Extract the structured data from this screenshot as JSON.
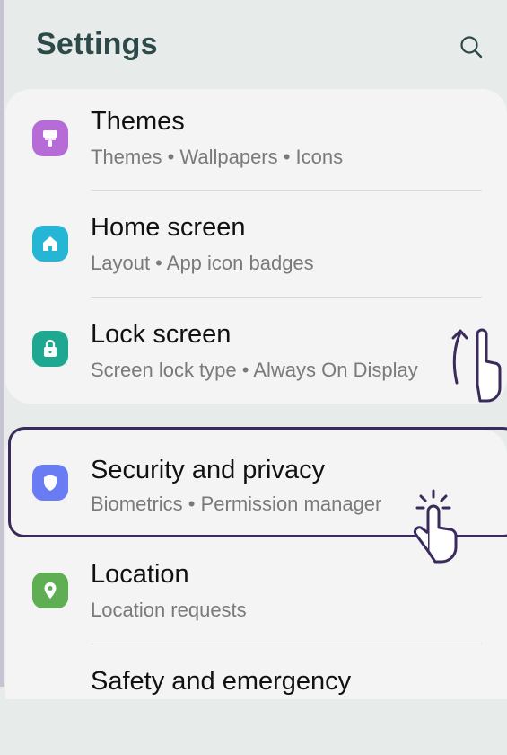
{
  "header": {
    "title": "Settings",
    "search_icon": "search-icon"
  },
  "items": [
    {
      "title": "Themes",
      "subtitle": "Themes  •  Wallpapers  •  Icons",
      "icon": "themes-icon",
      "color": "#b66bd6"
    },
    {
      "title": "Home screen",
      "subtitle": "Layout  •  App icon badges",
      "icon": "home-icon",
      "color": "#25b6d6"
    },
    {
      "title": "Lock screen",
      "subtitle": "Screen lock type  •  Always On Display",
      "icon": "lock-icon",
      "color": "#1fa891"
    },
    {
      "title": "Security and privacy",
      "subtitle": "Biometrics  •  Permission manager",
      "icon": "shield-icon",
      "color": "#6a7cf4"
    },
    {
      "title": "Location",
      "subtitle": "Location requests",
      "icon": "location-icon",
      "color": "#5fae54"
    },
    {
      "title": "Safety and emergency",
      "subtitle": "",
      "icon": "safety-icon",
      "color": "#e35d4e"
    }
  ],
  "colors": {
    "highlight_border": "#3b2a5c",
    "background": "#e7ebe9",
    "card": "#f3f4f3"
  }
}
